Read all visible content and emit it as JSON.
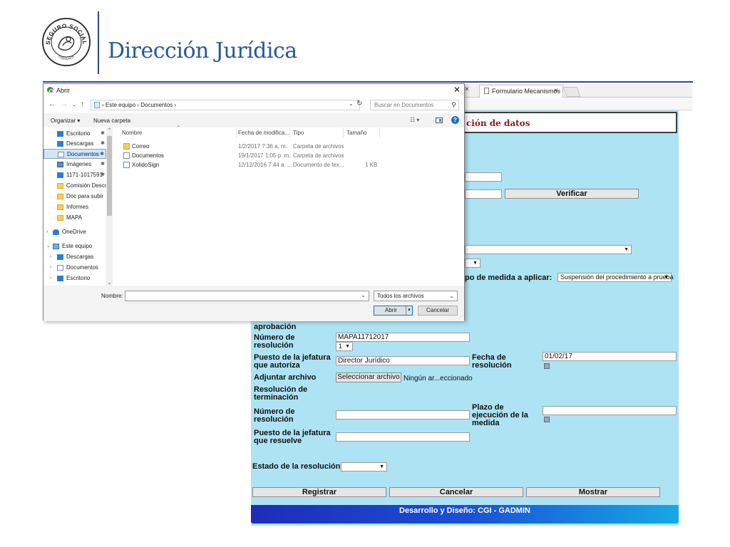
{
  "slide": {
    "title": "Dirección Jurídica",
    "logo_text_top": "SEGURO SOCIAL",
    "logo_text_bottom": "COSTA RICA"
  },
  "browser": {
    "tab_title": "Formulario Mecanismos",
    "tab_close": "×",
    "prev_tab_close": "×"
  },
  "dialog": {
    "title": "Abrir",
    "close_glyph": "✕",
    "address_path": "› Este equipo › Documentos ›",
    "search_placeholder": "Buscar en Documentos",
    "toolbar": {
      "organize": "Organizar ▾",
      "new_folder": "Nueva carpeta"
    },
    "columns": [
      "Nombre",
      "Fecha de modifica...",
      "Tipo",
      "Tamaño"
    ],
    "files": [
      {
        "name": "Correo",
        "date": "1/2/2017 7:36 a. m.",
        "type": "Carpeta de archivos",
        "size": "",
        "icon": "folder-icon"
      },
      {
        "name": "Documentos",
        "date": "19/1/2017 1:05 p. m.",
        "type": "Carpeta de archivos",
        "size": "",
        "icon": "document-folder-icon"
      },
      {
        "name": "XolidoSign",
        "date": "12/12/2016 7:44 a. ...",
        "type": "Documento de tex...",
        "size": "1 KB",
        "icon": "text-file-icon"
      }
    ],
    "nav_items": [
      {
        "label": "Escritorio",
        "icon": "blue",
        "pinned": true
      },
      {
        "label": "Descargas",
        "icon": "blue",
        "pinned": true
      },
      {
        "label": "Documentos",
        "icon": "doc",
        "pinned": true,
        "selected": true
      },
      {
        "label": "Imágenes",
        "icon": "img",
        "pinned": true
      },
      {
        "label": "1171-1017591",
        "icon": "blue",
        "pinned": true
      },
      {
        "label": "Comisión Desco",
        "icon": "folder"
      },
      {
        "label": "Doc para subir",
        "icon": "folder"
      },
      {
        "label": "Informes",
        "icon": "folder"
      },
      {
        "label": "MAPA",
        "icon": "folder"
      },
      {
        "label": "OneDrive",
        "icon": "cloud",
        "chevron": "›"
      },
      {
        "label": "Este equipo",
        "icon": "pc",
        "chevron": "⌄"
      },
      {
        "label": "Descargas",
        "icon": "blue",
        "chevron": "›",
        "indent": true
      },
      {
        "label": "Documentos",
        "icon": "doc",
        "chevron": "›",
        "indent": true
      },
      {
        "label": "Escritorio",
        "icon": "blue",
        "chevron": "›",
        "indent": true
      }
    ],
    "filename_label": "Nombre:",
    "filename_value": "",
    "filetype_value": "Todos los archivos",
    "open_label": "Abrir",
    "cancel_label": "Cancelar"
  },
  "form": {
    "heading": "ción de datos",
    "verify_button": "Verificar",
    "measure_label": "po de medida a aplicar:",
    "measure_value": "Suspensión del procedimiento a prueba",
    "approval_label": "aprobación",
    "resolution_number_label": "Número de resolución",
    "resolution_number_value": "MAPA11712017",
    "resolution_seq_value": "1",
    "authorizing_post_label": "Puesto de la jefatura que autoriza",
    "authorizing_post_value": "Director Jurídico",
    "resolution_date_label": "Fecha de resolución",
    "resolution_date_value": "01/02/17",
    "attach_label": "Adjuntar archivo",
    "select_file_button": "Seleccionar archivo",
    "no_file_text": "Ningún ar...eccionado",
    "termination_label": "Resolución de terminación",
    "termination_number_label": "Número de resolución",
    "execution_term_label": "Plazo de ejecución de la medida",
    "resolving_post_label": "Puesto de la jefatura que resuelve",
    "status_label": "Estado de la resolución",
    "register_button": "Registrar",
    "cancel_button": "Cancelar",
    "show_button": "Mostrar",
    "footer": "Desarrollo y Diseño: CGI - GADMIN"
  }
}
